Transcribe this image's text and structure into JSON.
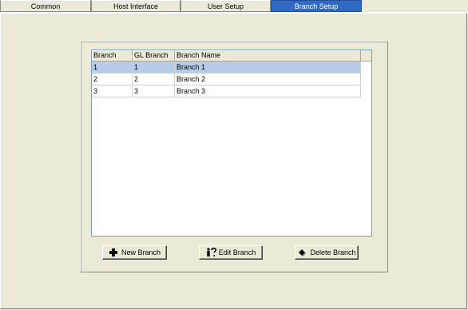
{
  "tabs": [
    {
      "label": "Common",
      "active": false
    },
    {
      "label": "Host Interface",
      "active": false
    },
    {
      "label": "User Setup",
      "active": false
    },
    {
      "label": "Branch Setup",
      "active": true
    }
  ],
  "table": {
    "columns": [
      "Branch",
      "GL Branch",
      "Branch Name"
    ],
    "rows": [
      {
        "branch": "1",
        "gl_branch": "1",
        "branch_name": "Branch 1",
        "selected": true
      },
      {
        "branch": "2",
        "gl_branch": "2",
        "branch_name": "Branch 2",
        "selected": false
      },
      {
        "branch": "3",
        "gl_branch": "3",
        "branch_name": "Branch 3",
        "selected": false
      }
    ]
  },
  "buttons": {
    "new_branch": {
      "label": "New Branch",
      "icon": "plus-icon"
    },
    "edit_branch": {
      "label": "Edit Branch",
      "icon": "person-question-icon"
    },
    "delete_branch": {
      "label": "Delete Branch",
      "icon": "eraser-icon"
    }
  },
  "colors": {
    "active_tab": "#316AC5",
    "selected_row": "#B6CCE8",
    "window_bg": "#ECE9D8"
  }
}
